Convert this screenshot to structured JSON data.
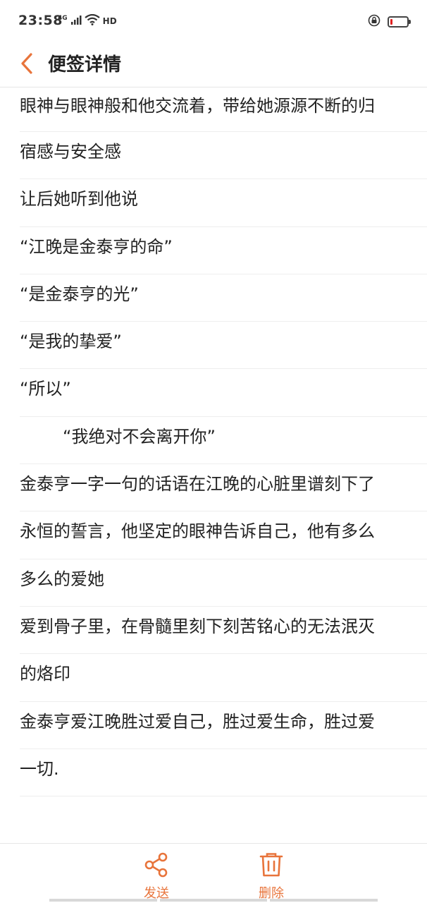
{
  "status_bar": {
    "time": "23:58",
    "network": "4G",
    "hd": "HD",
    "battery_level": 0.1
  },
  "header": {
    "title": "便签详情"
  },
  "note": {
    "lines": [
      "眼神与眼神般和他交流着，带给她源源不断的归",
      "宿感与安全感",
      "让后她听到他说",
      "“江晚是金泰亨的命”",
      "“是金泰亨的光”",
      "“是我的挚爱”",
      "“所以”",
      "        “我绝对不会离开你”",
      "金泰亨一字一句的话语在江晚的心脏里谱刻下了",
      "永恒的誓言，他坚定的眼神告诉自己，他有多么",
      "多么的爱她",
      "爱到骨子里，在骨髓里刻下刻苦铭心的无法泯灭",
      "的烙印",
      "金泰亨爱江晚胜过爱自己，胜过爱生命，胜过爱",
      "一切."
    ]
  },
  "actions": {
    "send_label": "发送",
    "delete_label": "删除"
  },
  "colors": {
    "accent": "#e8743b",
    "text": "#222222",
    "divider": "#eeeeee"
  }
}
